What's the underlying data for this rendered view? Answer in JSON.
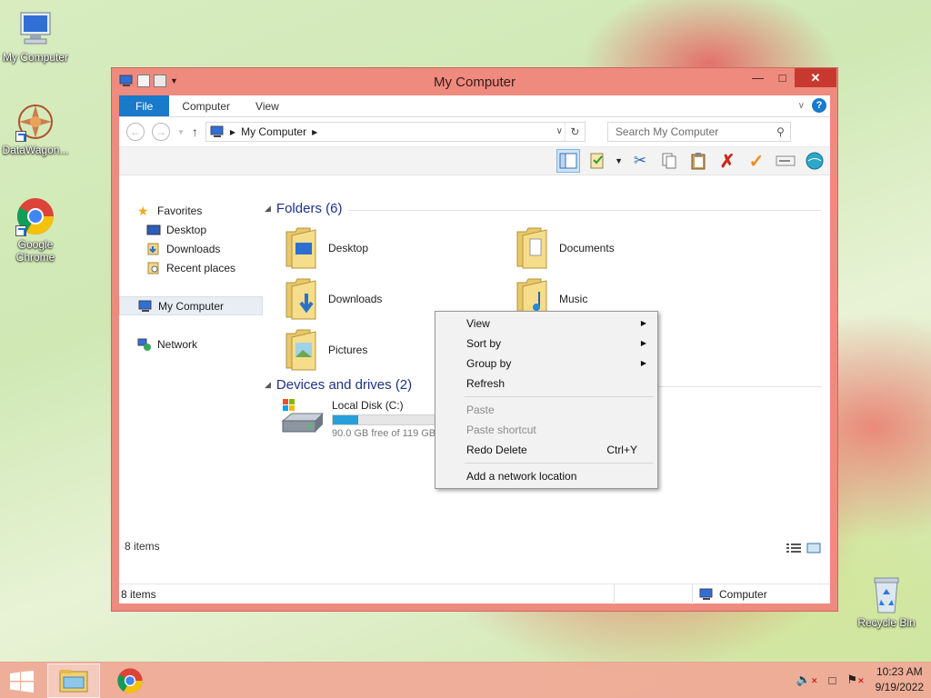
{
  "desktop": {
    "icons": [
      {
        "label": "My Computer"
      },
      {
        "label": "DataWagon..."
      },
      {
        "label": "Google Chrome"
      },
      {
        "label": "Recycle Bin"
      }
    ]
  },
  "window": {
    "title": "My Computer",
    "ribbon_tabs": [
      "File",
      "Computer",
      "View"
    ],
    "help": "?",
    "address": "My Computer",
    "search_placeholder": "Search My Computer"
  },
  "navpane": {
    "favorites": "Favorites",
    "fav_items": [
      "Desktop",
      "Downloads",
      "Recent places"
    ],
    "computer": "My Computer",
    "network": "Network"
  },
  "content": {
    "folders_header": "Folders (6)",
    "folders": [
      "Desktop",
      "Documents",
      "Downloads",
      "Music",
      "Pictures"
    ],
    "devices_header": "Devices and drives (2)",
    "drive": {
      "name": "Local Disk (C:)",
      "free_text": "90.0 GB free of 119 GB",
      "used_fraction": 0.244
    },
    "items_count": "8 items"
  },
  "statusbar": {
    "left": "8 items",
    "right": "Computer"
  },
  "context_menu": {
    "items": [
      {
        "label": "View",
        "submenu": true
      },
      {
        "label": "Sort by",
        "submenu": true
      },
      {
        "label": "Group by",
        "submenu": true
      },
      {
        "label": "Refresh"
      },
      {
        "label": "Paste",
        "disabled": true
      },
      {
        "label": "Paste shortcut",
        "disabled": true
      },
      {
        "label": "Redo Delete",
        "shortcut": "Ctrl+Y"
      },
      {
        "label": "Add a network location"
      }
    ]
  },
  "taskbar": {
    "time": "10:23 AM",
    "date": "9/19/2022"
  },
  "colors": {
    "accent": "#1979ca",
    "window_frame": "#ee8a7e",
    "close": "#c7392f",
    "drive_bar": "#26a0da"
  }
}
